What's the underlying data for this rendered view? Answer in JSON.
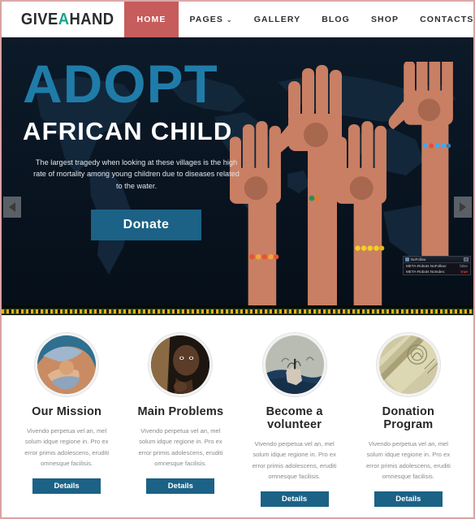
{
  "brand": {
    "part1": "GIVE",
    "accent": "A",
    "part2": "HAND"
  },
  "nav": {
    "items": [
      {
        "label": "HOME",
        "active": true,
        "caret": ""
      },
      {
        "label": "PAGES",
        "active": false,
        "caret": "⌄"
      },
      {
        "label": "GALLERY",
        "active": false,
        "caret": ""
      },
      {
        "label": "BLOG",
        "active": false,
        "caret": ""
      },
      {
        "label": "SHOP",
        "active": false,
        "caret": ""
      },
      {
        "label": "CONTACTS",
        "active": false,
        "caret": ""
      }
    ],
    "cart_icon": "shopping-cart-icon"
  },
  "hero": {
    "title": "ADOPT",
    "subtitle": "AFRICAN CHILD",
    "description": "The largest tragedy when looking at these villages is the high rate of mortality among young children due to diseases related to the water.",
    "cta_label": "Donate",
    "prev_icon": "chevron-left-icon",
    "next_icon": "chevron-right-icon",
    "title_color": "#1f7ca8",
    "cta_color": "#1b6286",
    "background_color": "#0a1724"
  },
  "popup": {
    "title": "NoFollow",
    "rows": [
      {
        "label": "META-Robots NoFollow:",
        "value": "false",
        "state": "false"
      },
      {
        "label": "META-Robots NoIndex:",
        "value": "true",
        "state": "true"
      }
    ],
    "minimize_icon": "minimize-icon"
  },
  "cards": [
    {
      "title": "Our Mission",
      "text": "Vivendo perpetua vel an, mel solum idque regione in. Pro ex error primis adolescens, eruditi omnesque facilisis.",
      "button": "Details",
      "image": "hands-holding-baby-photo"
    },
    {
      "title": "Main Problems",
      "text": "Vivendo perpetua vel an, mel solum idque regione in. Pro ex error primis adolescens, eruditi omnesque facilisis.",
      "button": "Details",
      "image": "african-child-portrait-photo"
    },
    {
      "title": "Become a volunteer",
      "text": "Vivendo perpetua vel an, mel solum idque regione in. Pro ex error primis adolescens, eruditi omnesque facilisis.",
      "button": "Details",
      "image": "hand-holding-seedling-photo"
    },
    {
      "title": "Donation Program",
      "text": "Vivendo perpetua vel an, mel solum idque regione in. Pro ex error primis adolescens, eruditi omnesque facilisis.",
      "button": "Details",
      "image": "banknote-money-photo"
    }
  ],
  "theme": {
    "accent_red": "#c75c5c",
    "accent_green": "#17a589",
    "accent_blue": "#1b6286",
    "band_yellow": "#e8b321",
    "band_green": "#1d4a1f"
  }
}
